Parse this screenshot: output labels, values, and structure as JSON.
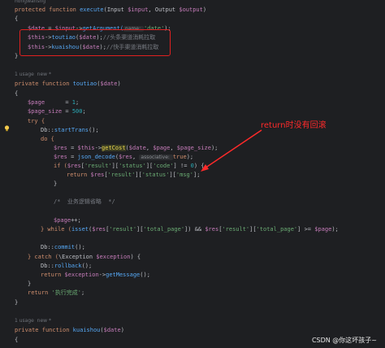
{
  "code": {
    "top_partial": "hongwansng",
    "execute_signature": [
      "protected",
      "function",
      "execute",
      "(Input ",
      "$input",
      ", Output ",
      "$output",
      ")"
    ],
    "brace_open": "{",
    "date_line": [
      "$date",
      " = ",
      "$input",
      "->",
      "getArgument(",
      "name: ",
      "'date'",
      ");"
    ],
    "toutiao_call": [
      "$this",
      "->",
      "toutiao",
      "(",
      "$date",
      ");",
      "//头条渠道消耗拉取"
    ],
    "kuaishou_call": [
      "$this",
      "->",
      "kuaishou",
      "(",
      "$date",
      ");",
      "//快手渠道消耗拉取"
    ],
    "brace_close": "}",
    "usage_hint_1": "1 usage  new *",
    "toutiao_signature": [
      "private",
      "function",
      "toutiao",
      "(",
      "$date",
      ")"
    ],
    "page_line": [
      "$page",
      "      = ",
      "1",
      ";"
    ],
    "page_size_line": [
      "$page_size",
      " = ",
      "500",
      ";"
    ],
    "try_line": "try {",
    "start_trans": [
      "Db::",
      "startTrans",
      "();"
    ],
    "do_line": "do {",
    "res_getcost": [
      "$res",
      " = ",
      "$this",
      "->",
      "getCost",
      "(",
      "$date",
      ", ",
      "$page",
      ", ",
      "$page_size",
      ");"
    ],
    "res_json": [
      "$res",
      " = ",
      "json_decode",
      "(",
      "$res",
      ", ",
      "associative: ",
      "true",
      ");"
    ],
    "if_line": [
      "if (",
      "$res",
      "[",
      "'result'",
      "][",
      "'status'",
      "][",
      "'code'",
      "] != ",
      "0",
      ") {"
    ],
    "return_line": [
      "return ",
      "$res",
      "[",
      "'result'",
      "][",
      "'status'",
      "][",
      "'msg'",
      "];"
    ],
    "inner_close": "}",
    "biz_comment": "/*  业务逻辑省略  */",
    "page_inc": [
      "$page",
      "++;"
    ],
    "while_line": [
      "} while (",
      "isset",
      "(",
      "$res",
      "[",
      "'result'",
      "][",
      "'total_page'",
      "]) && ",
      "$res",
      "[",
      "'result'",
      "][",
      "'total_page'",
      "] >= ",
      "$page",
      ");"
    ],
    "commit_line": [
      "Db::",
      "commit",
      "();"
    ],
    "catch_line": [
      "} catch (",
      "\\Exception ",
      "$exception",
      ") {"
    ],
    "rollback_line": [
      "Db::",
      "rollback",
      "();"
    ],
    "return_exception": [
      "return ",
      "$exception",
      "->",
      "getMessage",
      "();"
    ],
    "catch_close": "}",
    "return_done": [
      "return ",
      "'执行完成'",
      ";"
    ],
    "method_close": "}",
    "usage_hint_2": "1 usage  new *",
    "kuaishou_signature": [
      "private",
      "function",
      "kuaishou",
      "(",
      "$date",
      ")"
    ]
  },
  "annotation": "return时没有回滚",
  "watermark": "CSDN @你这坏孩子~",
  "colors": {
    "background": "#1e1f22",
    "annotation": "#ff2a2a",
    "highlight_box": "#e02020"
  },
  "icons": [
    "lightbulb-icon",
    "arrow-annotation"
  ]
}
